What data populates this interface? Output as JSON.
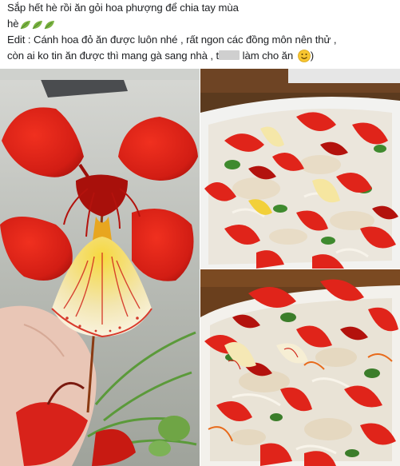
{
  "post": {
    "line1": "Sắp hết hè rồi ăn gỏi hoa phượng để chia tay mùa",
    "line2": "hè",
    "line3": "Edit : Cánh hoa đỏ ăn được luôn nhé , rất ngon các đồng môn nên thử ,",
    "line4a": "còn ai ko tin ăn được thì mang gà sang nhà , t",
    "line4b": " làm cho ăn ",
    "line4c": ")",
    "icons": [
      "leaf-emoji-icon",
      "leaf-emoji-icon",
      "leaf-emoji-icon",
      "smiley-emoji-icon"
    ]
  },
  "photos": [
    {
      "name": "flame-tree-flower-in-hand"
    },
    {
      "name": "flower-salad-plate-top"
    },
    {
      "name": "flower-salad-plate-bottom"
    }
  ],
  "colors": {
    "petal_red": "#e0241a",
    "petal_dark": "#b3120d",
    "standard_yellow": "#f2d03a",
    "background_gray": "#c4c6c1"
  }
}
